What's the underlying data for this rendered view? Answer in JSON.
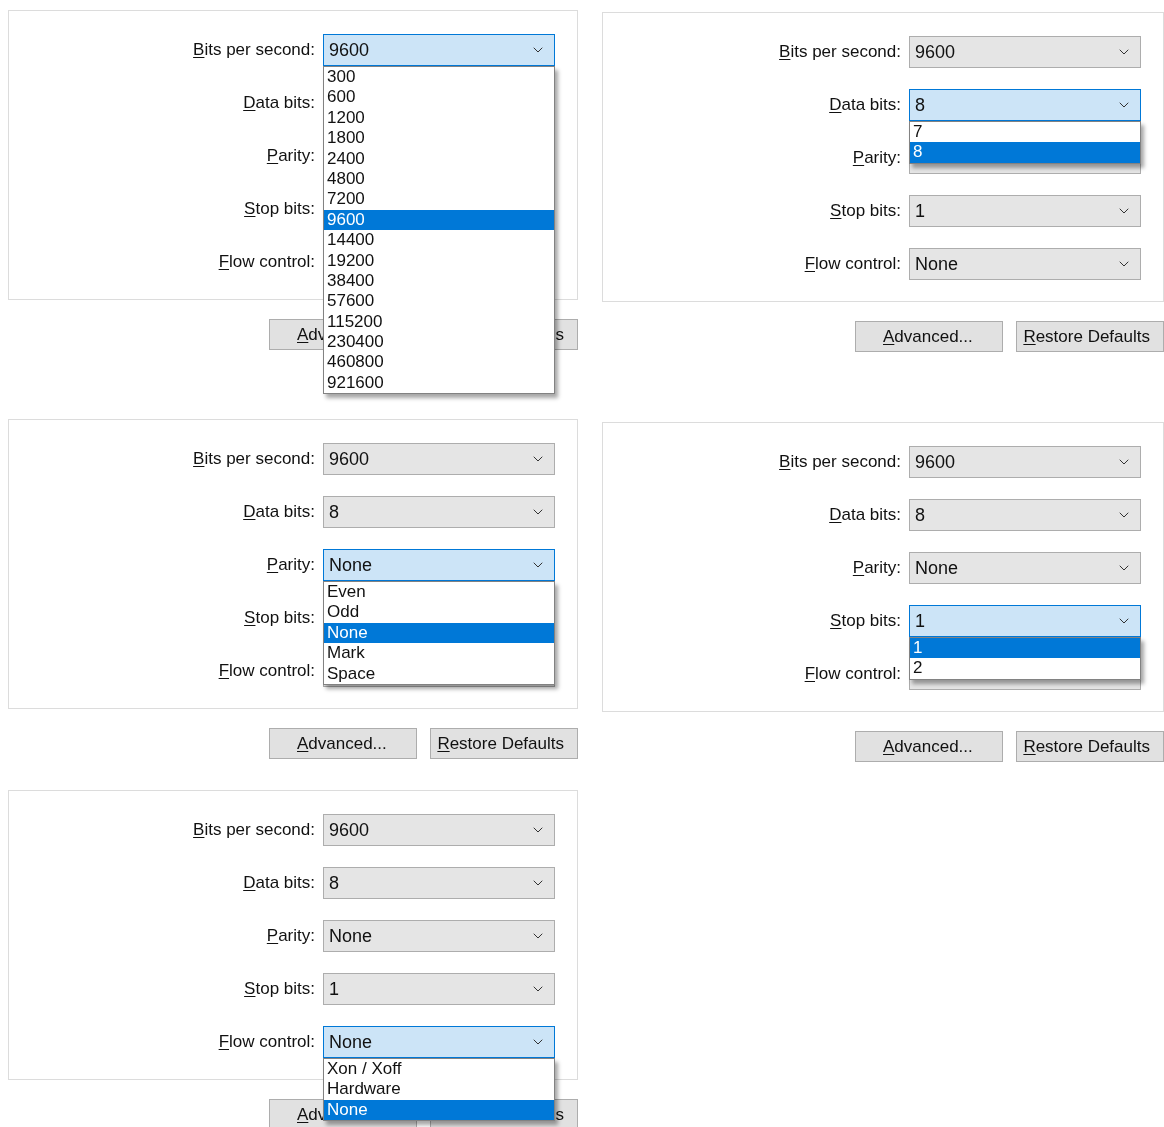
{
  "panels": [
    {
      "fields": [
        {
          "label": "Bits per second:",
          "mnemonic": true,
          "value": "9600",
          "open": true,
          "options": [
            {
              "text": "300",
              "selected": false
            },
            {
              "text": "600",
              "selected": false
            },
            {
              "text": "1200",
              "selected": false
            },
            {
              "text": "1800",
              "selected": false
            },
            {
              "text": "2400",
              "selected": false
            },
            {
              "text": "4800",
              "selected": false
            },
            {
              "text": "7200",
              "selected": false
            },
            {
              "text": "9600",
              "selected": true
            },
            {
              "text": "14400",
              "selected": false
            },
            {
              "text": "19200",
              "selected": false
            },
            {
              "text": "38400",
              "selected": false
            },
            {
              "text": "57600",
              "selected": false
            },
            {
              "text": "115200",
              "selected": false
            },
            {
              "text": "230400",
              "selected": false
            },
            {
              "text": "460800",
              "selected": false
            },
            {
              "text": "921600",
              "selected": false
            }
          ]
        },
        {
          "label": "Data bits:",
          "mnemonic": true,
          "open": false
        },
        {
          "label": "Parity:",
          "mnemonic": true,
          "open": false
        },
        {
          "label": "Stop bits:",
          "mnemonic": true,
          "open": false
        },
        {
          "label": "Flow control:",
          "mnemonic": true,
          "open": false
        }
      ],
      "buttons": [
        {
          "label": "Adv",
          "mnemonic": true
        },
        {
          "label": "s",
          "mnemonic": false
        }
      ]
    },
    {
      "fields": [
        {
          "label": "Bits per second:",
          "mnemonic": true,
          "value": "9600",
          "open": false
        },
        {
          "label": "Data bits:",
          "mnemonic": true,
          "value": "8",
          "open": true,
          "options": [
            {
              "text": "7",
              "selected": false
            },
            {
              "text": "8",
              "selected": true
            }
          ]
        },
        {
          "label": "Parity:",
          "mnemonic": true,
          "open": false
        },
        {
          "label": "Stop bits:",
          "mnemonic": true,
          "value": "1",
          "open": false
        },
        {
          "label": "Flow control:",
          "mnemonic": true,
          "value": "None",
          "open": false
        }
      ],
      "buttons": [
        {
          "label": "Advanced...",
          "mnemonic": true
        },
        {
          "label": "Restore Defaults",
          "mnemonic": true
        }
      ]
    },
    {
      "fields": [
        {
          "label": "Bits per second:",
          "mnemonic": true,
          "value": "9600",
          "open": false
        },
        {
          "label": "Data bits:",
          "mnemonic": true,
          "value": "8",
          "open": false
        },
        {
          "label": "Parity:",
          "mnemonic": true,
          "value": "None",
          "open": true,
          "options": [
            {
              "text": "Even",
              "selected": false
            },
            {
              "text": "Odd",
              "selected": false
            },
            {
              "text": "None",
              "selected": true
            },
            {
              "text": "Mark",
              "selected": false
            },
            {
              "text": "Space",
              "selected": false
            }
          ]
        },
        {
          "label": "Stop bits:",
          "mnemonic": true,
          "open": false
        },
        {
          "label": "Flow control:",
          "mnemonic": true,
          "open": false
        }
      ],
      "buttons": [
        {
          "label": "Advanced...",
          "mnemonic": true
        },
        {
          "label": "Restore Defaults",
          "mnemonic": true
        }
      ]
    },
    {
      "fields": [
        {
          "label": "Bits per second:",
          "mnemonic": true,
          "value": "9600",
          "open": false
        },
        {
          "label": "Data bits:",
          "mnemonic": true,
          "value": "8",
          "open": false
        },
        {
          "label": "Parity:",
          "mnemonic": true,
          "value": "None",
          "open": false
        },
        {
          "label": "Stop bits:",
          "mnemonic": true,
          "value": "1",
          "open": true,
          "options": [
            {
              "text": "1",
              "selected": true
            },
            {
              "text": "2",
              "selected": false
            }
          ]
        },
        {
          "label": "Flow control:",
          "mnemonic": true,
          "open": false
        }
      ],
      "buttons": [
        {
          "label": "Advanced...",
          "mnemonic": true
        },
        {
          "label": "Restore Defaults",
          "mnemonic": true
        }
      ]
    },
    {
      "fields": [
        {
          "label": "Bits per second:",
          "mnemonic": true,
          "value": "9600",
          "open": false
        },
        {
          "label": "Data bits:",
          "mnemonic": true,
          "value": "8",
          "open": false
        },
        {
          "label": "Parity:",
          "mnemonic": true,
          "value": "None",
          "open": false
        },
        {
          "label": "Stop bits:",
          "mnemonic": true,
          "value": "1",
          "open": false
        },
        {
          "label": "Flow control:",
          "mnemonic": true,
          "value": "None",
          "open": true,
          "options": [
            {
              "text": "Xon / Xoff",
              "selected": false
            },
            {
              "text": "Hardware",
              "selected": false
            },
            {
              "text": "None",
              "selected": true
            }
          ]
        }
      ],
      "buttons": [
        {
          "label": "Adv",
          "mnemonic": true
        },
        {
          "label": "s",
          "mnemonic": false
        }
      ]
    }
  ]
}
